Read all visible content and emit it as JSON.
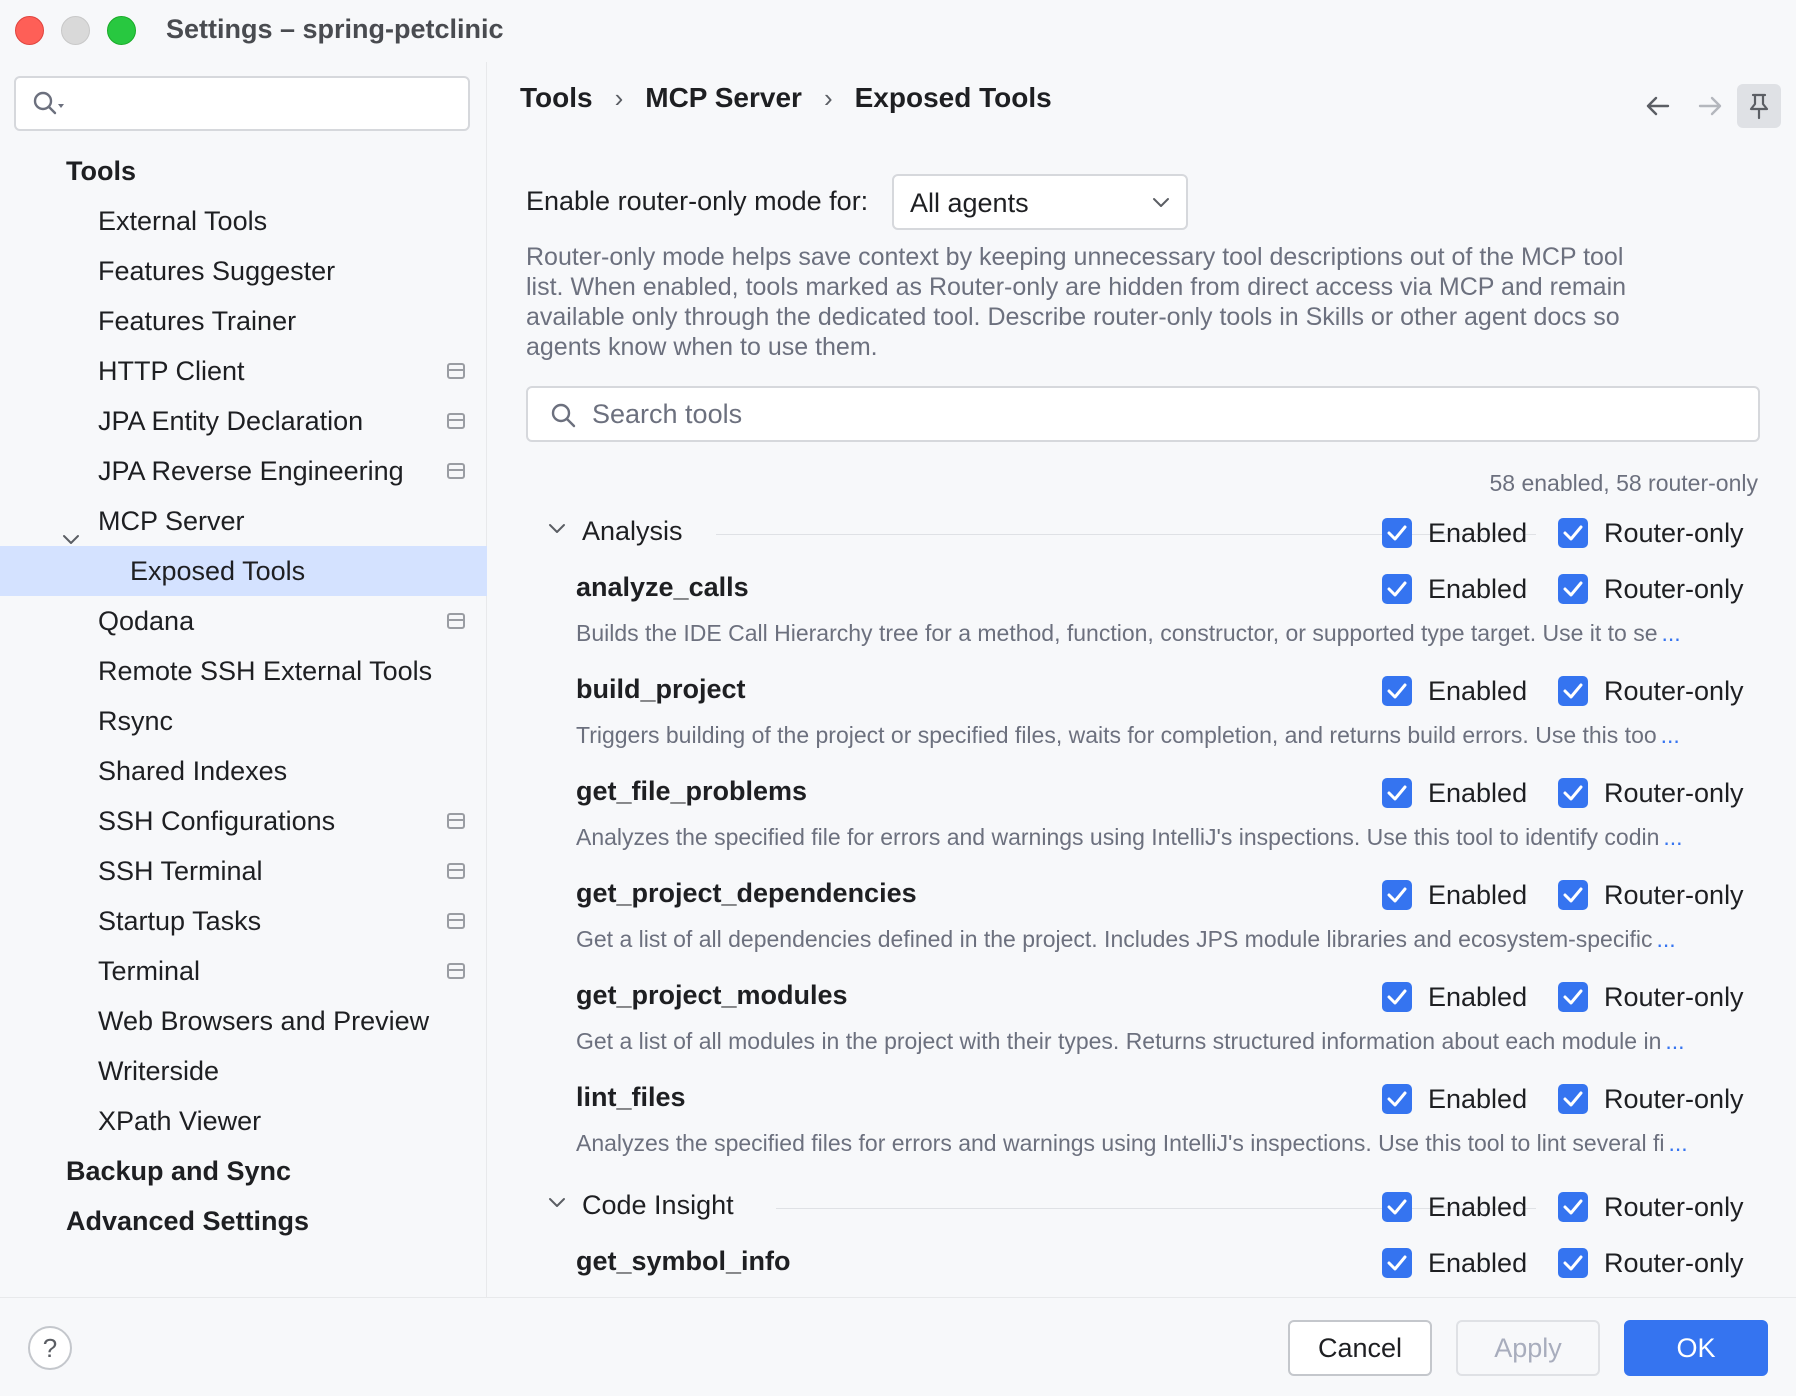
{
  "window": {
    "title": "Settings – spring-petclinic"
  },
  "sidebar": {
    "search_placeholder": "",
    "items": [
      {
        "label": "Tools",
        "level": 0
      },
      {
        "label": "External Tools",
        "level": 1
      },
      {
        "label": "Features Suggester",
        "level": 1
      },
      {
        "label": "Features Trainer",
        "level": 1
      },
      {
        "label": "HTTP Client",
        "level": 1,
        "project_icon": true
      },
      {
        "label": "JPA Entity Declaration",
        "level": 1,
        "project_icon": true
      },
      {
        "label": "JPA Reverse Engineering",
        "level": 1,
        "project_icon": true
      },
      {
        "label": "MCP Server",
        "level": 1,
        "expanded": true
      },
      {
        "label": "Exposed Tools",
        "level": 2,
        "selected": true
      },
      {
        "label": "Qodana",
        "level": 1,
        "project_icon": true
      },
      {
        "label": "Remote SSH External Tools",
        "level": 1
      },
      {
        "label": "Rsync",
        "level": 1
      },
      {
        "label": "Shared Indexes",
        "level": 1
      },
      {
        "label": "SSH Configurations",
        "level": 1,
        "project_icon": true
      },
      {
        "label": "SSH Terminal",
        "level": 1,
        "project_icon": true
      },
      {
        "label": "Startup Tasks",
        "level": 1,
        "project_icon": true
      },
      {
        "label": "Terminal",
        "level": 1,
        "project_icon": true
      },
      {
        "label": "Web Browsers and Preview",
        "level": 1
      },
      {
        "label": "Writerside",
        "level": 1
      },
      {
        "label": "XPath Viewer",
        "level": 1
      },
      {
        "label": "Backup and Sync",
        "level": 0
      },
      {
        "label": "Advanced Settings",
        "level": 0
      }
    ]
  },
  "breadcrumb": [
    "Tools",
    "MCP Server",
    "Exposed Tools"
  ],
  "breadcrumb_sep": "›",
  "router_mode": {
    "label": "Enable router-only mode for:",
    "selected": "All agents",
    "description": "Router-only mode helps save context by keeping unnecessary tool descriptions out of the MCP tool list. When enabled, tools marked as Router-only are hidden from direct access via MCP and remain available only through the dedicated tool. Describe router-only tools in Skills or other agent docs so agents know when to use them."
  },
  "tool_search": {
    "placeholder": "Search tools",
    "value": ""
  },
  "counts": "58 enabled, 58 router-only",
  "labels": {
    "enabled": "Enabled",
    "router_only": "Router-only",
    "ellipsis": "..."
  },
  "groups": [
    {
      "name": "Analysis",
      "enabled": true,
      "router_only": true,
      "tools": [
        {
          "name": "analyze_calls",
          "description": "Builds the IDE Call Hierarchy tree for a method, function, constructor, or supported type target. Use it to se",
          "enabled": true,
          "router_only": true
        },
        {
          "name": "build_project",
          "description": "Triggers building of the project or specified files, waits for completion, and returns build errors. Use this too",
          "enabled": true,
          "router_only": true
        },
        {
          "name": "get_file_problems",
          "description": "Analyzes the specified file for errors and warnings using IntelliJ's inspections. Use this tool to identify codin",
          "enabled": true,
          "router_only": true
        },
        {
          "name": "get_project_dependencies",
          "description": "Get a list of all dependencies defined in the project. Includes JPS module libraries and ecosystem-specific",
          "enabled": true,
          "router_only": true
        },
        {
          "name": "get_project_modules",
          "description": "Get a list of all modules in the project with their types. Returns structured information about each module in",
          "enabled": true,
          "router_only": true
        },
        {
          "name": "lint_files",
          "description": "Analyzes the specified files for errors and warnings using IntelliJ's inspections. Use this tool to lint several fi",
          "enabled": true,
          "router_only": true
        }
      ]
    },
    {
      "name": "Code Insight",
      "enabled": true,
      "router_only": true,
      "tools": [
        {
          "name": "get_symbol_info",
          "description": "",
          "enabled": true,
          "router_only": true
        }
      ]
    }
  ],
  "footer": {
    "help": "?",
    "cancel": "Cancel",
    "apply": "Apply",
    "ok": "OK"
  },
  "colors": {
    "accent": "#3574f0",
    "selected_row": "#d4e2ff",
    "muted_text": "#6c707e"
  }
}
